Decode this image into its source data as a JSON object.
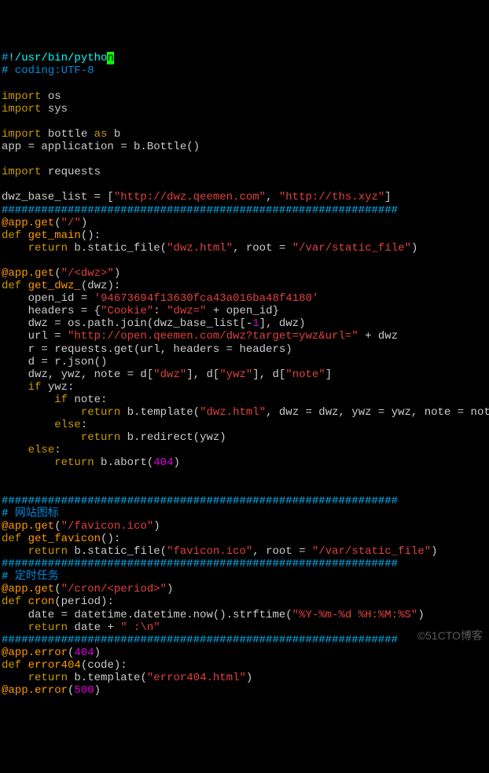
{
  "lines": [
    {
      "segments": [
        {
          "cls": "hash",
          "t": "#"
        },
        {
          "cls": "cursor-line",
          "t": "!/usr/bin/pytho"
        },
        {
          "cls": "cursor-bg",
          "t": "n"
        }
      ]
    },
    {
      "segments": [
        {
          "cls": "hash",
          "t": "#"
        },
        {
          "cls": "comment",
          "t": " coding:UTF-8"
        }
      ]
    },
    {
      "segments": [
        {
          "cls": "plain",
          "t": " "
        }
      ]
    },
    {
      "segments": [
        {
          "cls": "kw",
          "t": "import"
        },
        {
          "cls": "plain",
          "t": " os"
        }
      ]
    },
    {
      "segments": [
        {
          "cls": "kw",
          "t": "import"
        },
        {
          "cls": "plain",
          "t": " sys"
        }
      ]
    },
    {
      "segments": [
        {
          "cls": "plain",
          "t": " "
        }
      ]
    },
    {
      "segments": [
        {
          "cls": "kw",
          "t": "import"
        },
        {
          "cls": "plain",
          "t": " bottle "
        },
        {
          "cls": "kw",
          "t": "as"
        },
        {
          "cls": "plain",
          "t": " b"
        }
      ]
    },
    {
      "segments": [
        {
          "cls": "plain",
          "t": "app = application = b.Bottle()"
        }
      ]
    },
    {
      "segments": [
        {
          "cls": "plain",
          "t": " "
        }
      ]
    },
    {
      "segments": [
        {
          "cls": "kw",
          "t": "import"
        },
        {
          "cls": "plain",
          "t": " requests"
        }
      ]
    },
    {
      "segments": [
        {
          "cls": "plain",
          "t": " "
        }
      ]
    },
    {
      "segments": [
        {
          "cls": "plain",
          "t": "dwz_base_list = ["
        },
        {
          "cls": "string",
          "t": "\"http://dwz.qeemen.com\""
        },
        {
          "cls": "plain",
          "t": ", "
        },
        {
          "cls": "string",
          "t": "\"http://ths.xyz\""
        },
        {
          "cls": "plain",
          "t": "]"
        }
      ]
    },
    {
      "segments": [
        {
          "cls": "sep",
          "t": "############################################################"
        }
      ]
    },
    {
      "segments": [
        {
          "cls": "decor",
          "t": "@app.get"
        },
        {
          "cls": "plain",
          "t": "("
        },
        {
          "cls": "string",
          "t": "\"/\""
        },
        {
          "cls": "plain",
          "t": ")"
        }
      ]
    },
    {
      "segments": [
        {
          "cls": "kw",
          "t": "def"
        },
        {
          "cls": "plain",
          "t": " "
        },
        {
          "cls": "decor",
          "t": "get_main"
        },
        {
          "cls": "plain",
          "t": "():"
        }
      ]
    },
    {
      "segments": [
        {
          "cls": "plain",
          "t": "    "
        },
        {
          "cls": "kw",
          "t": "return"
        },
        {
          "cls": "plain",
          "t": " b.static_file("
        },
        {
          "cls": "string",
          "t": "\"dwz.html\""
        },
        {
          "cls": "plain",
          "t": ", root = "
        },
        {
          "cls": "string",
          "t": "\"/var/static_file\""
        },
        {
          "cls": "plain",
          "t": ")"
        }
      ]
    },
    {
      "segments": [
        {
          "cls": "plain",
          "t": " "
        }
      ]
    },
    {
      "segments": [
        {
          "cls": "decor",
          "t": "@app.get"
        },
        {
          "cls": "plain",
          "t": "("
        },
        {
          "cls": "string",
          "t": "\"/<dwz>\""
        },
        {
          "cls": "plain",
          "t": ")"
        }
      ]
    },
    {
      "segments": [
        {
          "cls": "kw",
          "t": "def"
        },
        {
          "cls": "plain",
          "t": " "
        },
        {
          "cls": "decor",
          "t": "get_dwz_"
        },
        {
          "cls": "plain",
          "t": "(dwz):"
        }
      ]
    },
    {
      "segments": [
        {
          "cls": "plain",
          "t": "    open_id = "
        },
        {
          "cls": "string",
          "t": "'94673694f13630fca43a016ba48f4180'"
        }
      ]
    },
    {
      "segments": [
        {
          "cls": "plain",
          "t": "    headers = {"
        },
        {
          "cls": "string",
          "t": "\"Cookie\""
        },
        {
          "cls": "plain",
          "t": ": "
        },
        {
          "cls": "string",
          "t": "\"dwz=\""
        },
        {
          "cls": "plain",
          "t": " + open_id}"
        }
      ]
    },
    {
      "segments": [
        {
          "cls": "plain",
          "t": "    dwz = os.path.join(dwz_base_list[-"
        },
        {
          "cls": "num",
          "t": "1"
        },
        {
          "cls": "plain",
          "t": "], dwz)"
        }
      ]
    },
    {
      "segments": [
        {
          "cls": "plain",
          "t": "    url = "
        },
        {
          "cls": "string",
          "t": "\"http://open.qeemen.com/dwz?target=ywz&url=\""
        },
        {
          "cls": "plain",
          "t": " + dwz"
        }
      ]
    },
    {
      "segments": [
        {
          "cls": "plain",
          "t": "    r = requests.get(url, headers = headers)"
        }
      ]
    },
    {
      "segments": [
        {
          "cls": "plain",
          "t": "    d = r.json()"
        }
      ]
    },
    {
      "segments": [
        {
          "cls": "plain",
          "t": "    dwz, ywz, note = d["
        },
        {
          "cls": "string",
          "t": "\"dwz\""
        },
        {
          "cls": "plain",
          "t": "], d["
        },
        {
          "cls": "string",
          "t": "\"ywz\""
        },
        {
          "cls": "plain",
          "t": "], d["
        },
        {
          "cls": "string",
          "t": "\"note\""
        },
        {
          "cls": "plain",
          "t": "]"
        }
      ]
    },
    {
      "segments": [
        {
          "cls": "plain",
          "t": "    "
        },
        {
          "cls": "kw",
          "t": "if"
        },
        {
          "cls": "plain",
          "t": " ywz:"
        }
      ]
    },
    {
      "segments": [
        {
          "cls": "plain",
          "t": "        "
        },
        {
          "cls": "kw",
          "t": "if"
        },
        {
          "cls": "plain",
          "t": " note:"
        }
      ]
    },
    {
      "segments": [
        {
          "cls": "plain",
          "t": "            "
        },
        {
          "cls": "kw",
          "t": "return"
        },
        {
          "cls": "plain",
          "t": " b.template("
        },
        {
          "cls": "string",
          "t": "\"dwz.html\""
        },
        {
          "cls": "plain",
          "t": ", dwz = dwz, ywz = ywz, note = note)"
        }
      ]
    },
    {
      "segments": [
        {
          "cls": "plain",
          "t": "        "
        },
        {
          "cls": "kw",
          "t": "else"
        },
        {
          "cls": "plain",
          "t": ":"
        }
      ]
    },
    {
      "segments": [
        {
          "cls": "plain",
          "t": "            "
        },
        {
          "cls": "kw",
          "t": "return"
        },
        {
          "cls": "plain",
          "t": " b.redirect(ywz)"
        }
      ]
    },
    {
      "segments": [
        {
          "cls": "plain",
          "t": "    "
        },
        {
          "cls": "kw",
          "t": "else"
        },
        {
          "cls": "plain",
          "t": ":"
        }
      ]
    },
    {
      "segments": [
        {
          "cls": "plain",
          "t": "        "
        },
        {
          "cls": "kw",
          "t": "return"
        },
        {
          "cls": "plain",
          "t": " b.abort("
        },
        {
          "cls": "num",
          "t": "404"
        },
        {
          "cls": "plain",
          "t": ")"
        }
      ]
    },
    {
      "segments": [
        {
          "cls": "plain",
          "t": " "
        }
      ]
    },
    {
      "segments": [
        {
          "cls": "plain",
          "t": " "
        }
      ]
    },
    {
      "segments": [
        {
          "cls": "sep",
          "t": "############################################################"
        }
      ]
    },
    {
      "segments": [
        {
          "cls": "hash",
          "t": "#"
        },
        {
          "cls": "comment",
          "t": " 网站图标"
        }
      ]
    },
    {
      "segments": [
        {
          "cls": "decor",
          "t": "@app.get"
        },
        {
          "cls": "plain",
          "t": "("
        },
        {
          "cls": "string",
          "t": "\"/favicon.ico\""
        },
        {
          "cls": "plain",
          "t": ")"
        }
      ]
    },
    {
      "segments": [
        {
          "cls": "kw",
          "t": "def"
        },
        {
          "cls": "plain",
          "t": " "
        },
        {
          "cls": "decor",
          "t": "get_favicon"
        },
        {
          "cls": "plain",
          "t": "():"
        }
      ]
    },
    {
      "segments": [
        {
          "cls": "plain",
          "t": "    "
        },
        {
          "cls": "kw",
          "t": "return"
        },
        {
          "cls": "plain",
          "t": " b.static_file("
        },
        {
          "cls": "string",
          "t": "\"favicon.ico\""
        },
        {
          "cls": "plain",
          "t": ", root = "
        },
        {
          "cls": "string",
          "t": "\"/var/static_file\""
        },
        {
          "cls": "plain",
          "t": ")"
        }
      ]
    },
    {
      "segments": [
        {
          "cls": "sep",
          "t": "############################################################"
        }
      ]
    },
    {
      "segments": [
        {
          "cls": "hash",
          "t": "#"
        },
        {
          "cls": "comment",
          "t": " 定时任务"
        }
      ]
    },
    {
      "segments": [
        {
          "cls": "decor",
          "t": "@app.get"
        },
        {
          "cls": "plain",
          "t": "("
        },
        {
          "cls": "string",
          "t": "\"/cron/<period>\""
        },
        {
          "cls": "plain",
          "t": ")"
        }
      ]
    },
    {
      "segments": [
        {
          "cls": "kw",
          "t": "def"
        },
        {
          "cls": "plain",
          "t": " "
        },
        {
          "cls": "decor",
          "t": "cron"
        },
        {
          "cls": "plain",
          "t": "(period):"
        }
      ]
    },
    {
      "segments": [
        {
          "cls": "plain",
          "t": "    date = datetime.datetime.now().strftime("
        },
        {
          "cls": "string",
          "t": "\"%Y-%m-%d %H:%M:%S\""
        },
        {
          "cls": "plain",
          "t": ")"
        }
      ]
    },
    {
      "segments": [
        {
          "cls": "plain",
          "t": "    "
        },
        {
          "cls": "kw",
          "t": "return"
        },
        {
          "cls": "plain",
          "t": " date + "
        },
        {
          "cls": "string",
          "t": "\" :\\n\""
        }
      ]
    },
    {
      "segments": [
        {
          "cls": "sep",
          "t": "############################################################"
        }
      ]
    },
    {
      "segments": [
        {
          "cls": "decor",
          "t": "@app.error"
        },
        {
          "cls": "plain",
          "t": "("
        },
        {
          "cls": "num",
          "t": "404"
        },
        {
          "cls": "plain",
          "t": ")"
        }
      ]
    },
    {
      "segments": [
        {
          "cls": "kw",
          "t": "def"
        },
        {
          "cls": "plain",
          "t": " "
        },
        {
          "cls": "decor",
          "t": "error404"
        },
        {
          "cls": "plain",
          "t": "(code):"
        }
      ]
    },
    {
      "segments": [
        {
          "cls": "plain",
          "t": "    "
        },
        {
          "cls": "kw",
          "t": "return"
        },
        {
          "cls": "plain",
          "t": " b.template("
        },
        {
          "cls": "string",
          "t": "\"error404.html\""
        },
        {
          "cls": "plain",
          "t": ")"
        }
      ]
    },
    {
      "segments": [
        {
          "cls": "decor",
          "t": "@app.error"
        },
        {
          "cls": "plain",
          "t": "("
        },
        {
          "cls": "num",
          "t": "500"
        },
        {
          "cls": "plain",
          "t": ")"
        }
      ]
    }
  ],
  "watermark": "©51CTO博客"
}
